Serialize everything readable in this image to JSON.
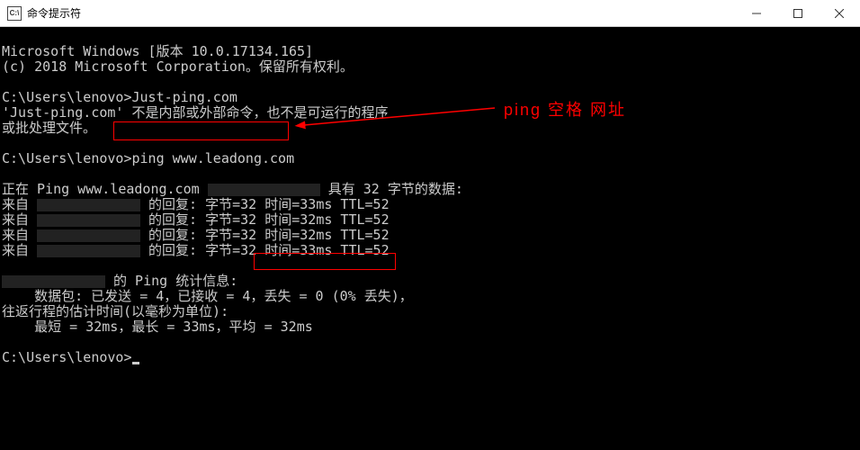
{
  "titlebar": {
    "icon_label": "C:\\",
    "title": "命令提示符"
  },
  "header": {
    "line1": "Microsoft Windows [版本 10.0.17134.165]",
    "line2": "(c) 2018 Microsoft Corporation。保留所有权利。"
  },
  "cmd1": {
    "prompt": "C:\\Users\\lenovo>",
    "command": "Just-ping.com",
    "error_l1": "'Just-ping.com' 不是内部或外部命令，也不是可运行的程序",
    "error_l2": "或批处理文件。"
  },
  "cmd2": {
    "prompt": "C:\\Users\\lenovo>",
    "command": "ping www.leadong.com"
  },
  "ping": {
    "header_pre": "正在 Ping www.leadong.com ",
    "header_post": " 具有 32 字节的数据:",
    "reply_prefix": "来自 ",
    "r1": " 的回复: 字节=32 时间=33ms TTL=52",
    "r2": " 的回复: 字节=32 时间=32ms TTL=52",
    "r3": " 的回复: 字节=32 时间=32ms TTL=52",
    "r4": " 的回复: 字节=32 时间=33ms TTL=52",
    "stats_title_post": " 的 Ping 统计信息:",
    "packets_pre": "    数据包: 已发送 = 4，已接收 = 4，",
    "packets_loss": "丢失 = 0 (0% 丢失)，",
    "rtt_title": "往返行程的估计时间(以毫秒为单位):",
    "rtt_values": "    最短 = 32ms，最长 = 33ms，平均 = 32ms"
  },
  "cmd3": {
    "prompt": "C:\\Users\\lenovo>"
  },
  "annotation": {
    "text": "ping 空格  网址"
  }
}
